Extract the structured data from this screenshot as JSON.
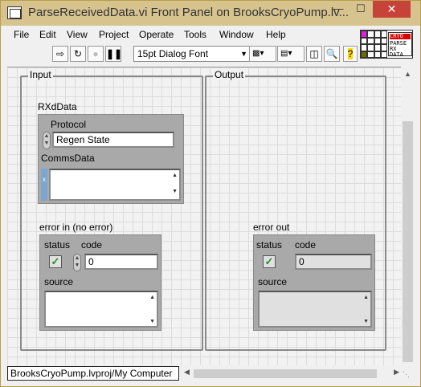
{
  "window": {
    "title": "ParseReceivedData.vi Front Panel on BrooksCryoPump.lv...",
    "min_icon": "minimize-icon",
    "max_icon": "maximize-icon",
    "close_icon": "close-icon"
  },
  "menu": [
    "File",
    "Edit",
    "View",
    "Project",
    "Operate",
    "Tools",
    "Window",
    "Help"
  ],
  "toolbar": {
    "font_select": "15pt Dialog Font"
  },
  "vi_icon": {
    "line1": "CRYO",
    "line2": "PARSE",
    "line3": "RX",
    "line4": "DATA"
  },
  "input_cluster": {
    "title": "Input",
    "rxd_label": "RXdData",
    "protocol_label": "Protocol",
    "protocol_value": "Regen State",
    "comms_label": "CommsData",
    "comms_index": "x",
    "error_in_label": "error in (no error)",
    "status_label": "status",
    "code_label": "code",
    "code_value": "0",
    "source_label": "source",
    "status_mark": "✓"
  },
  "output_cluster": {
    "title": "Output",
    "error_out_label": "error out",
    "status_label": "status",
    "code_label": "code",
    "code_value": "0",
    "source_label": "source",
    "status_mark": "✓"
  },
  "statusbar": {
    "text": "BrooksCryoPump.lvproj/My Computer"
  }
}
